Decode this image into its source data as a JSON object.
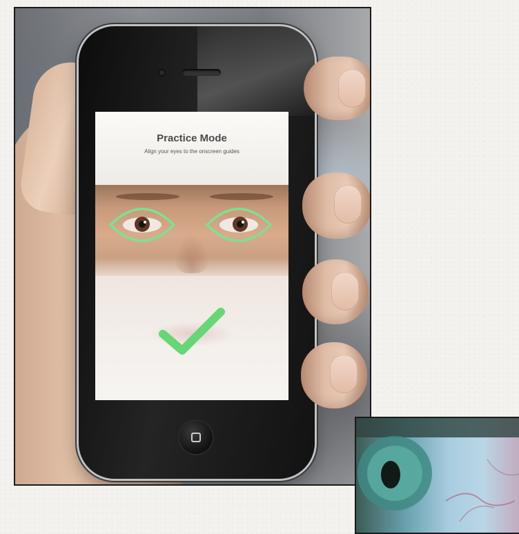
{
  "screen": {
    "title": "Practice Mode",
    "subtitle": "Align your eyes to the onscreen guides"
  },
  "icons": {
    "eye_guide": "eye-outline-guide",
    "check": "check-icon",
    "home": "home-button"
  },
  "colors": {
    "guide_green": "#7fe08f",
    "check_green": "#67d676",
    "phone_black": "#111111",
    "screen_bg": "#f6f4f0"
  }
}
